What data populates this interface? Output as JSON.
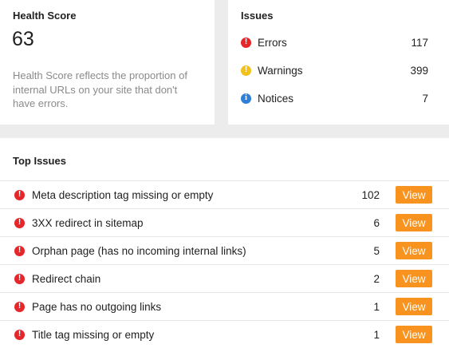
{
  "health": {
    "title": "Health Score",
    "score": "63",
    "description": "Health Score reflects the proportion of internal URLs on your site that don't have errors."
  },
  "issues": {
    "title": "Issues",
    "rows": [
      {
        "label": "Errors",
        "count": "117",
        "icon": "error-icon",
        "color": "#e5262a"
      },
      {
        "label": "Warnings",
        "count": "399",
        "icon": "warning-icon",
        "color": "#f2c21b"
      },
      {
        "label": "Notices",
        "count": "7",
        "icon": "info-icon",
        "color": "#2f7fd8"
      }
    ]
  },
  "top_issues": {
    "title": "Top Issues",
    "view_label": "View",
    "accent": "#f7931e",
    "rows": [
      {
        "label": "Meta description tag missing or empty",
        "count": "102"
      },
      {
        "label": "3XX redirect in sitemap",
        "count": "6"
      },
      {
        "label": "Orphan page (has no incoming internal links)",
        "count": "5"
      },
      {
        "label": "Redirect chain",
        "count": "2"
      },
      {
        "label": "Page has no outgoing links",
        "count": "1"
      },
      {
        "label": "Title tag missing or empty",
        "count": "1"
      }
    ]
  }
}
